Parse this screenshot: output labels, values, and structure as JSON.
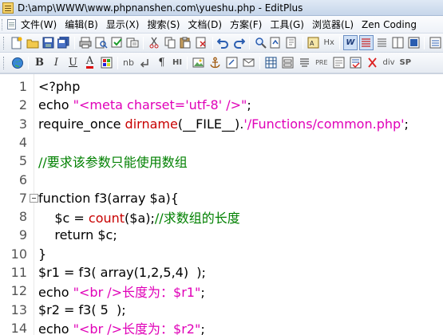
{
  "window": {
    "title": "D:\\amp\\WWW\\www.phpnanshen.com\\yueshu.php - EditPlus"
  },
  "menu": [
    "文件(W)",
    "编辑(B)",
    "显示(X)",
    "搜索(S)",
    "文档(D)",
    "方案(F)",
    "工具(G)",
    "浏览器(L)",
    "Zen Coding"
  ],
  "toolbar2_labels": {
    "b": "B",
    "i": "I",
    "u": "U",
    "a": "A",
    "nb": "nb",
    "pilcrow": "¶",
    "hi": "HI",
    "pre": "PRE",
    "div": "div",
    "sp": "SP",
    "hx": "Hx",
    "w": "W"
  },
  "editor": {
    "lines": [
      {
        "n": "1",
        "tokens": [
          [
            "code",
            "<?php"
          ]
        ]
      },
      {
        "n": "2",
        "tokens": [
          [
            "code",
            "echo "
          ],
          [
            "str",
            "\"<meta charset='utf-8' />\""
          ],
          [
            "code",
            ";"
          ]
        ]
      },
      {
        "n": "3",
        "tokens": [
          [
            "code",
            "require_once "
          ],
          [
            "fn",
            "dirname"
          ],
          [
            "code",
            "(__FILE__)."
          ],
          [
            "str",
            "'/Functions/common.php'"
          ],
          [
            "code",
            ";"
          ]
        ]
      },
      {
        "n": "4",
        "tokens": []
      },
      {
        "n": "5",
        "tokens": [
          [
            "cmt",
            "//要求该参数只能使用数组"
          ]
        ]
      },
      {
        "n": "6",
        "tokens": []
      },
      {
        "n": "7",
        "fold": true,
        "tokens": [
          [
            "code",
            "function f3(array $a){"
          ]
        ]
      },
      {
        "n": "8",
        "tokens": [
          [
            "code",
            "    $c = "
          ],
          [
            "fn",
            "count"
          ],
          [
            "code",
            "($a);"
          ],
          [
            "cmt",
            "//求数组的长度"
          ]
        ]
      },
      {
        "n": "9",
        "tokens": [
          [
            "code",
            "    return $c;"
          ]
        ]
      },
      {
        "n": "10",
        "tokens": [
          [
            "code",
            "}"
          ]
        ]
      },
      {
        "n": "11",
        "tokens": [
          [
            "code",
            "$r1 = f3( array(1,2,5,4)  );"
          ]
        ]
      },
      {
        "n": "12",
        "tokens": [
          [
            "code",
            "echo "
          ],
          [
            "str",
            "\"<br />长度为：$r1\""
          ],
          [
            "code",
            ";"
          ]
        ]
      },
      {
        "n": "13",
        "tokens": [
          [
            "code",
            "$r2 = f3( 5  );"
          ]
        ]
      },
      {
        "n": "14",
        "tokens": [
          [
            "code",
            "echo "
          ],
          [
            "str",
            "\"<br />长度为：$r2\""
          ],
          [
            "code",
            ";"
          ]
        ]
      }
    ]
  },
  "colors": {
    "string": "#e000b8",
    "comment": "#008000",
    "function": "#c80000"
  }
}
